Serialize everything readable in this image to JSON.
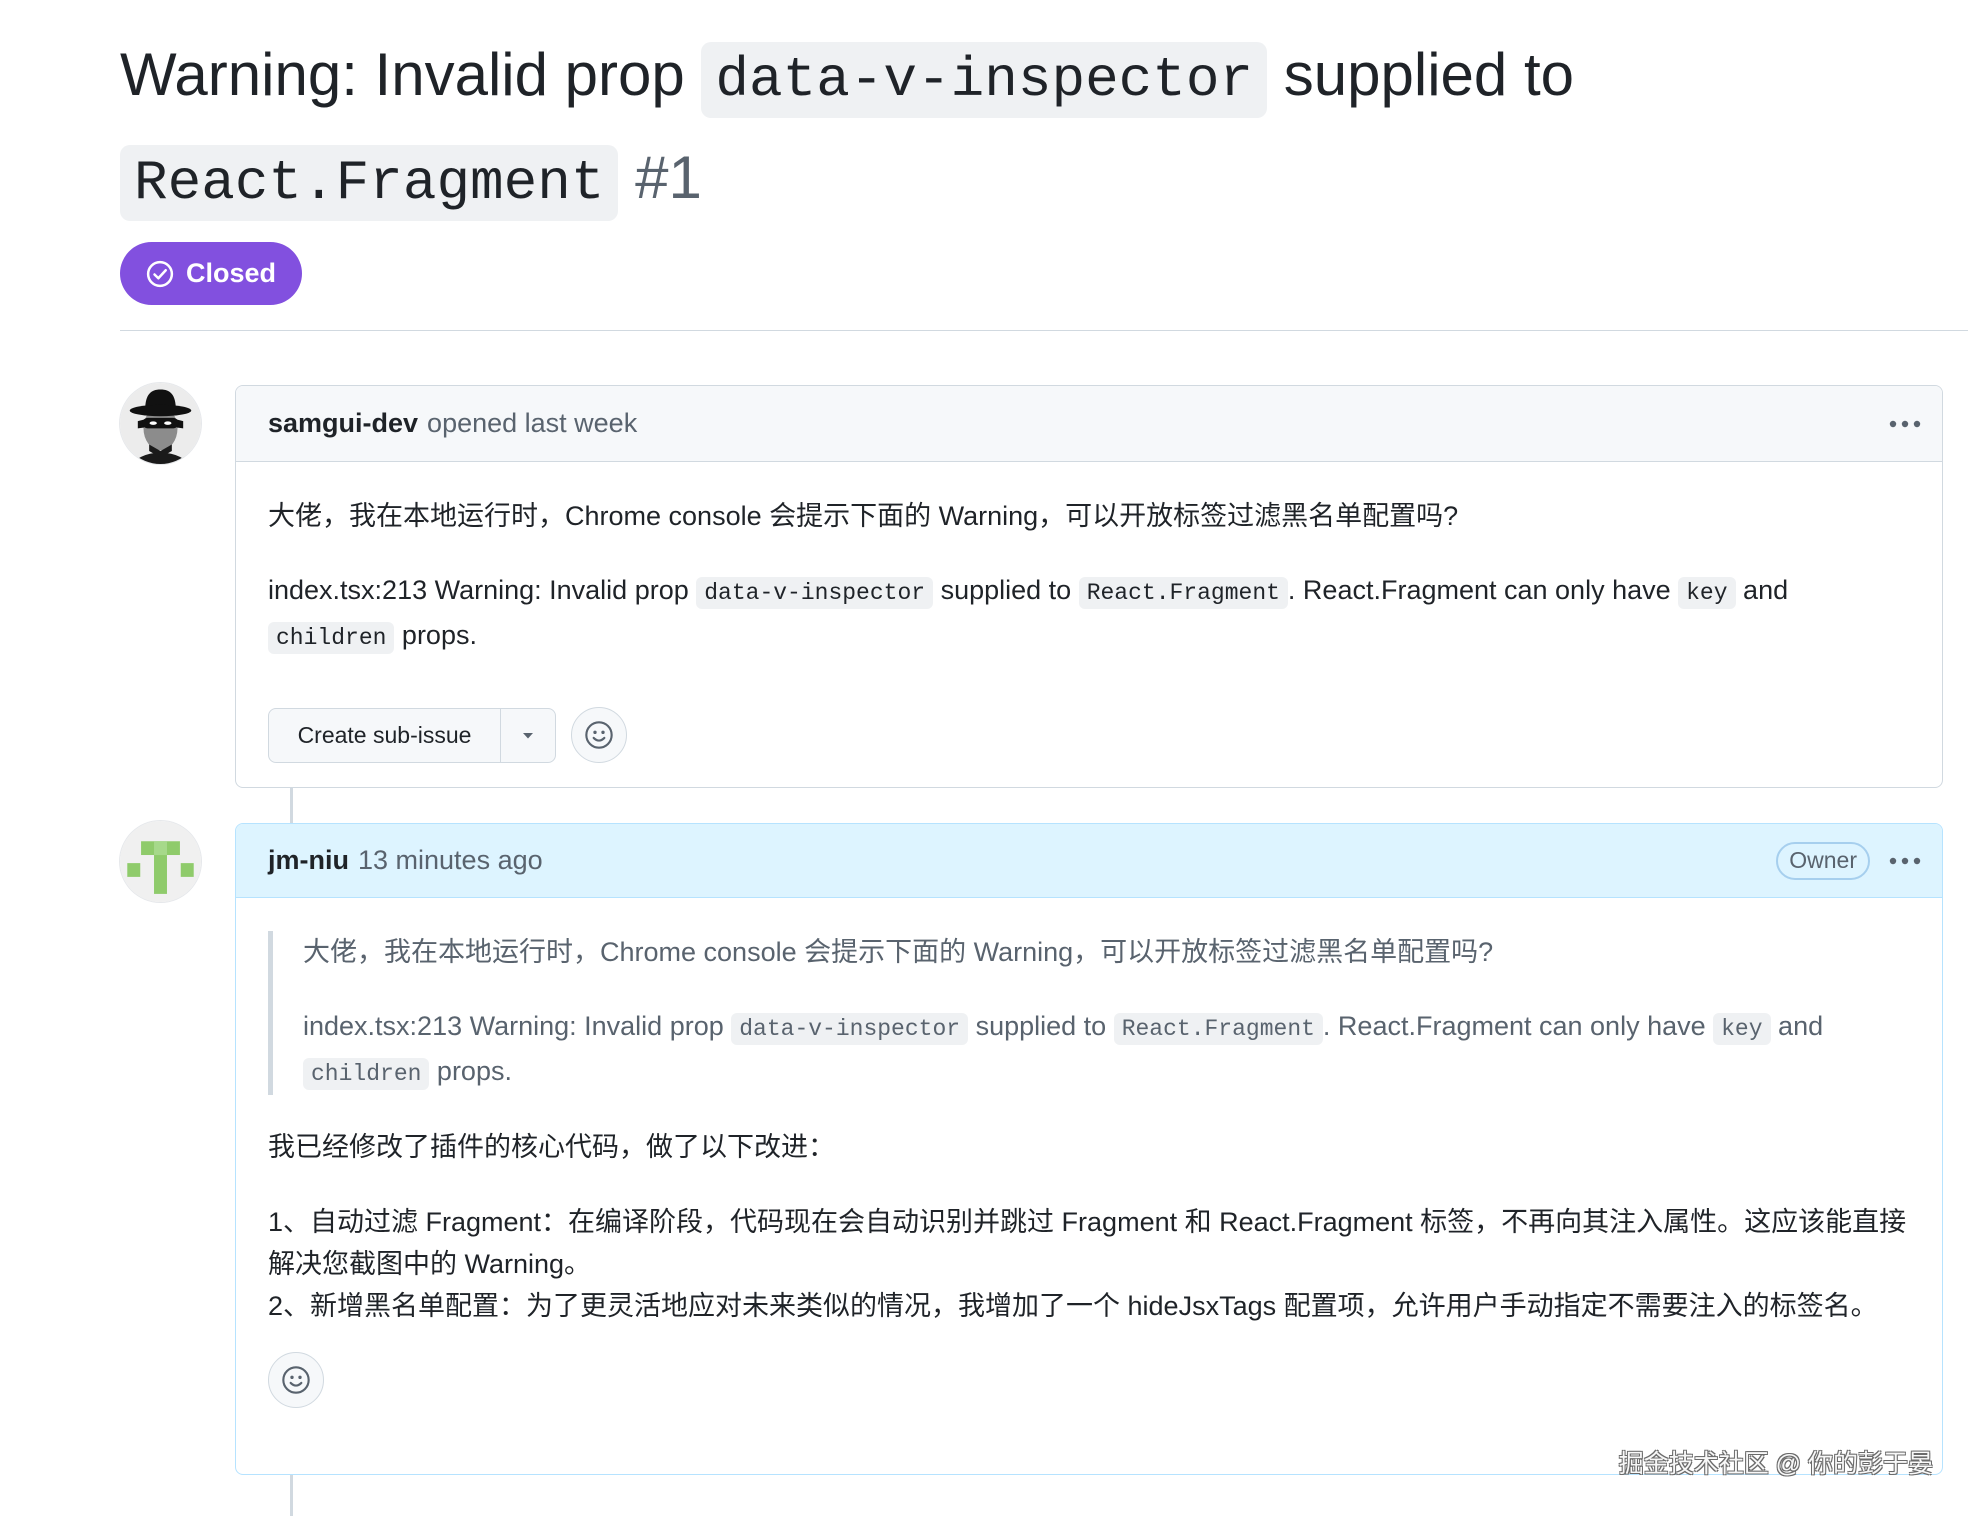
{
  "issue": {
    "title": {
      "text_1": "Warning: Invalid prop",
      "code_1": "data-v-inspector",
      "text_2": "supplied to",
      "code_2": "React.Fragment",
      "number": "#1"
    },
    "state": {
      "label": "Closed",
      "icon": "check-circle-icon",
      "color": "#8250df"
    }
  },
  "comments": [
    {
      "author": "samgui-dev",
      "meta": "opened last week",
      "avatar_icon": "spy-avatar",
      "menu_icon": "kebab-horizontal-icon",
      "body": {
        "paragraph": "大佬，我在本地运行时，Chrome console 会提示下面的 Warning，可以开放标签过滤黑名单配置吗?",
        "warning": [
          "index.tsx:213 Warning: Invalid prop ",
          "data-v-inspector",
          " supplied to ",
          "React.Fragment",
          ". React.Fragment can only have ",
          "key",
          " and ",
          "children",
          " props."
        ]
      },
      "actions": {
        "create_sub_issue_label": "Create sub-issue",
        "dropdown_icon": "triangle-down-icon",
        "reaction_icon": "smiley-icon"
      }
    },
    {
      "author": "jm-niu",
      "meta": "13 minutes ago",
      "role_badge": "Owner",
      "avatar_icon": "identicon",
      "menu_icon": "kebab-horizontal-icon",
      "header_color": "#ddf4ff",
      "body": {
        "quote": {
          "paragraph": "大佬，我在本地运行时，Chrome console 会提示下面的 Warning，可以开放标签过滤黑名单配置吗?",
          "warning": [
            "index.tsx:213 Warning: Invalid prop ",
            "data-v-inspector",
            " supplied to ",
            "React.Fragment",
            ". React.Fragment can only have ",
            "key",
            " and ",
            "children",
            " props."
          ]
        },
        "intro": "我已经修改了插件的核心代码，做了以下改进：",
        "improvements": [
          "1、自动过滤 Fragment：在编译阶段，代码现在会自动识别并跳过 Fragment 和 React.Fragment 标签，不再向其注入属性。这应该能直接解决您截图中的 Warning。",
          "2、新增黑名单配置：为了更灵活地应对未来类似的情况，我增加了一个 hideJsxTags 配置项，允许用户手动指定不需要注入的标签名。"
        ]
      },
      "actions": {
        "reaction_icon": "smiley-icon"
      }
    }
  ],
  "watermark": "掘金技术社区 @ 你的彭于晏"
}
